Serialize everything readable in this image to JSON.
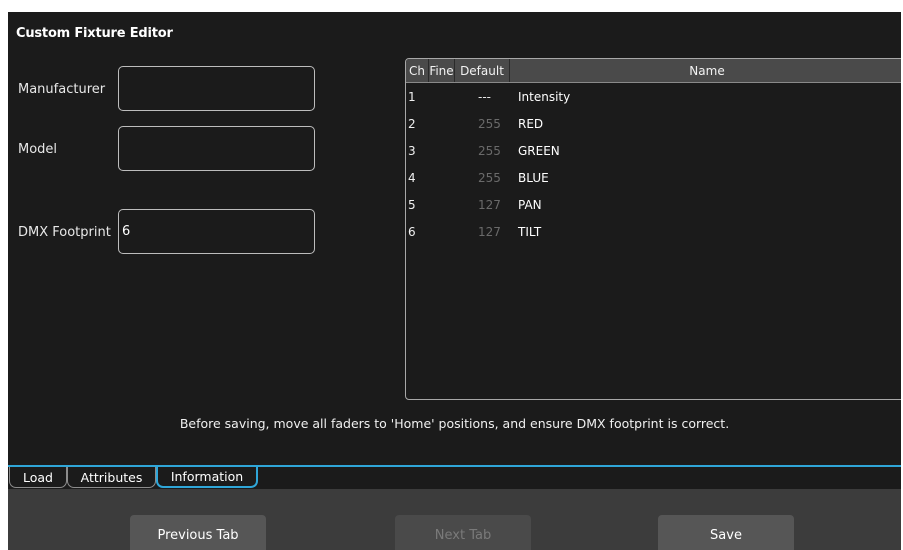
{
  "window": {
    "title": "Custom Fixture Editor"
  },
  "fields": {
    "manufacturer": {
      "label": "Manufacturer",
      "value": ""
    },
    "model": {
      "label": "Model",
      "value": ""
    },
    "dmx_footprint": {
      "label": "DMX Footprint",
      "value": "6"
    }
  },
  "channel_table": {
    "headers": {
      "ch": "Ch",
      "fine": "Fine",
      "default": "Default",
      "name": "Name"
    },
    "rows": [
      {
        "ch": "1",
        "fine": "",
        "default": "---",
        "name": "Intensity"
      },
      {
        "ch": "2",
        "fine": "",
        "default": "255",
        "name": "RED"
      },
      {
        "ch": "3",
        "fine": "",
        "default": "255",
        "name": "GREEN"
      },
      {
        "ch": "4",
        "fine": "",
        "default": "255",
        "name": "BLUE"
      },
      {
        "ch": "5",
        "fine": "",
        "default": "127",
        "name": "PAN"
      },
      {
        "ch": "6",
        "fine": "",
        "default": "127",
        "name": "TILT"
      }
    ]
  },
  "notice": "Before saving, move all faders to 'Home' positions, and ensure DMX footprint is correct.",
  "tabs": [
    {
      "label": "Load",
      "active": false
    },
    {
      "label": "Attributes",
      "active": false
    },
    {
      "label": "Information",
      "active": true
    }
  ],
  "buttons": {
    "previous": {
      "label": "Previous Tab",
      "enabled": true
    },
    "next": {
      "label": "Next Tab",
      "enabled": false
    },
    "save": {
      "label": "Save",
      "enabled": true
    }
  },
  "colors": {
    "accent": "#2fa6d8",
    "background": "#1b1b1b",
    "button_bar": "#3c3c3c"
  }
}
